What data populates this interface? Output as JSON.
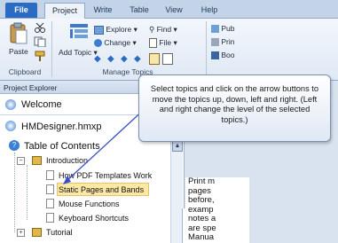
{
  "tabs": [
    "File",
    "Project",
    "Write",
    "Table",
    "View",
    "Help"
  ],
  "ribbon": {
    "paste_label": "Paste",
    "clipboard_group": "Clipboard",
    "add_topic_label": "Add Topic",
    "explore_label": "Explore",
    "find_label": "Find",
    "change_label": "Change",
    "file_label": "File",
    "manage_topics_group": "Manage Topics",
    "right_labels": [
      "Pub",
      "Prin",
      "Boo"
    ]
  },
  "explorer": {
    "title": "Project Explorer",
    "welcome": "Welcome",
    "project_file": "HMDesigner.hmxp",
    "toc": "Table of Contents",
    "items": [
      {
        "label": "Introduction"
      },
      {
        "label": "How PDF Templates Work"
      },
      {
        "label": "Static Pages and Bands"
      },
      {
        "label": "Mouse Functions"
      },
      {
        "label": "Keyboard Shortcuts"
      },
      {
        "label": "Tutorial"
      }
    ]
  },
  "callout": {
    "text": "Select topics and click on the arrow buttons to move the topics up, down, left and right. (Left and right change the level of the selected topics.)"
  },
  "document_lines": [
    "Print m",
    "pages",
    "before,",
    "examp",
    "notes a",
    "are spe",
    "Manua"
  ],
  "colors": {
    "file_tab": "#2a6bc4",
    "selection": "#fde9a6"
  }
}
